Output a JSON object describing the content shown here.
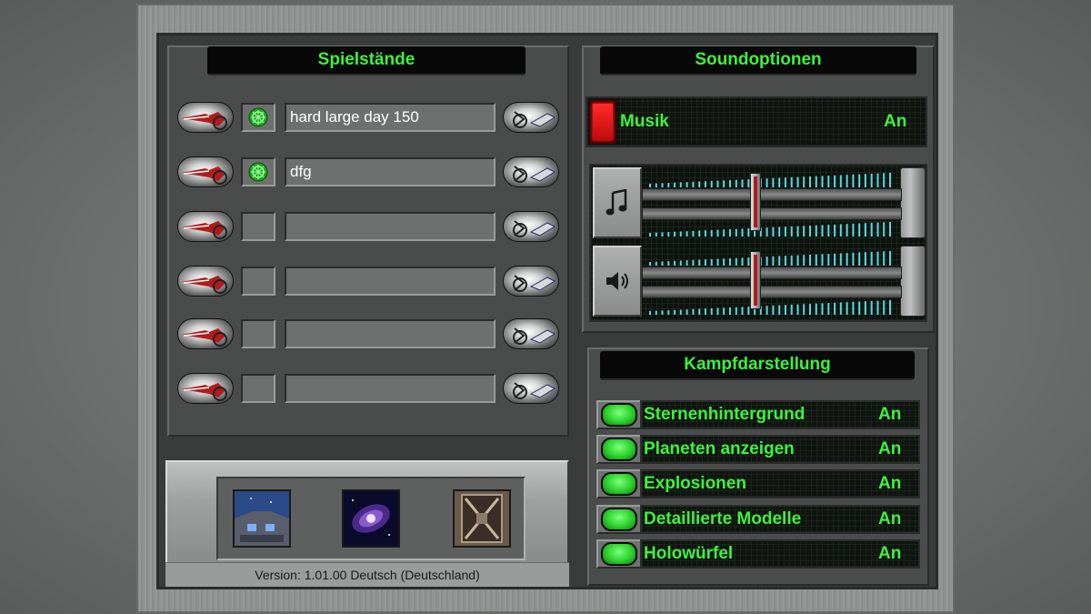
{
  "savegames": {
    "title": "Spielstände",
    "slots": [
      {
        "name": "hard large day 150",
        "has_icon": true
      },
      {
        "name": "dfg",
        "has_icon": true
      },
      {
        "name": "",
        "has_icon": false
      },
      {
        "name": "",
        "has_icon": false
      },
      {
        "name": "",
        "has_icon": false
      },
      {
        "name": "",
        "has_icon": false
      }
    ]
  },
  "sound": {
    "title": "Soundoptionen",
    "music": {
      "label": "Musik",
      "value": "An"
    },
    "music_volume": 0.44,
    "effects_volume": 0.44,
    "music_icon": "music-note-icon",
    "effects_icon": "speaker-icon"
  },
  "combat": {
    "title": "Kampfdarstellung",
    "options": [
      {
        "label": "Sternenhintergrund",
        "value": "An"
      },
      {
        "label": "Planeten anzeigen",
        "value": "An"
      },
      {
        "label": "Explosionen",
        "value": "An"
      },
      {
        "label": "Detaillierte Modelle",
        "value": "An"
      },
      {
        "label": "Holowürfel",
        "value": "An"
      }
    ]
  },
  "menu_icons": [
    "ship-cockpit-icon",
    "galaxy-icon",
    "exit-door-icon"
  ],
  "version": "Version: 1.01.00 Deutsch (Deutschland)",
  "colors": {
    "accent_green": "#3df23d",
    "music_toggle_red": "#d81414"
  }
}
